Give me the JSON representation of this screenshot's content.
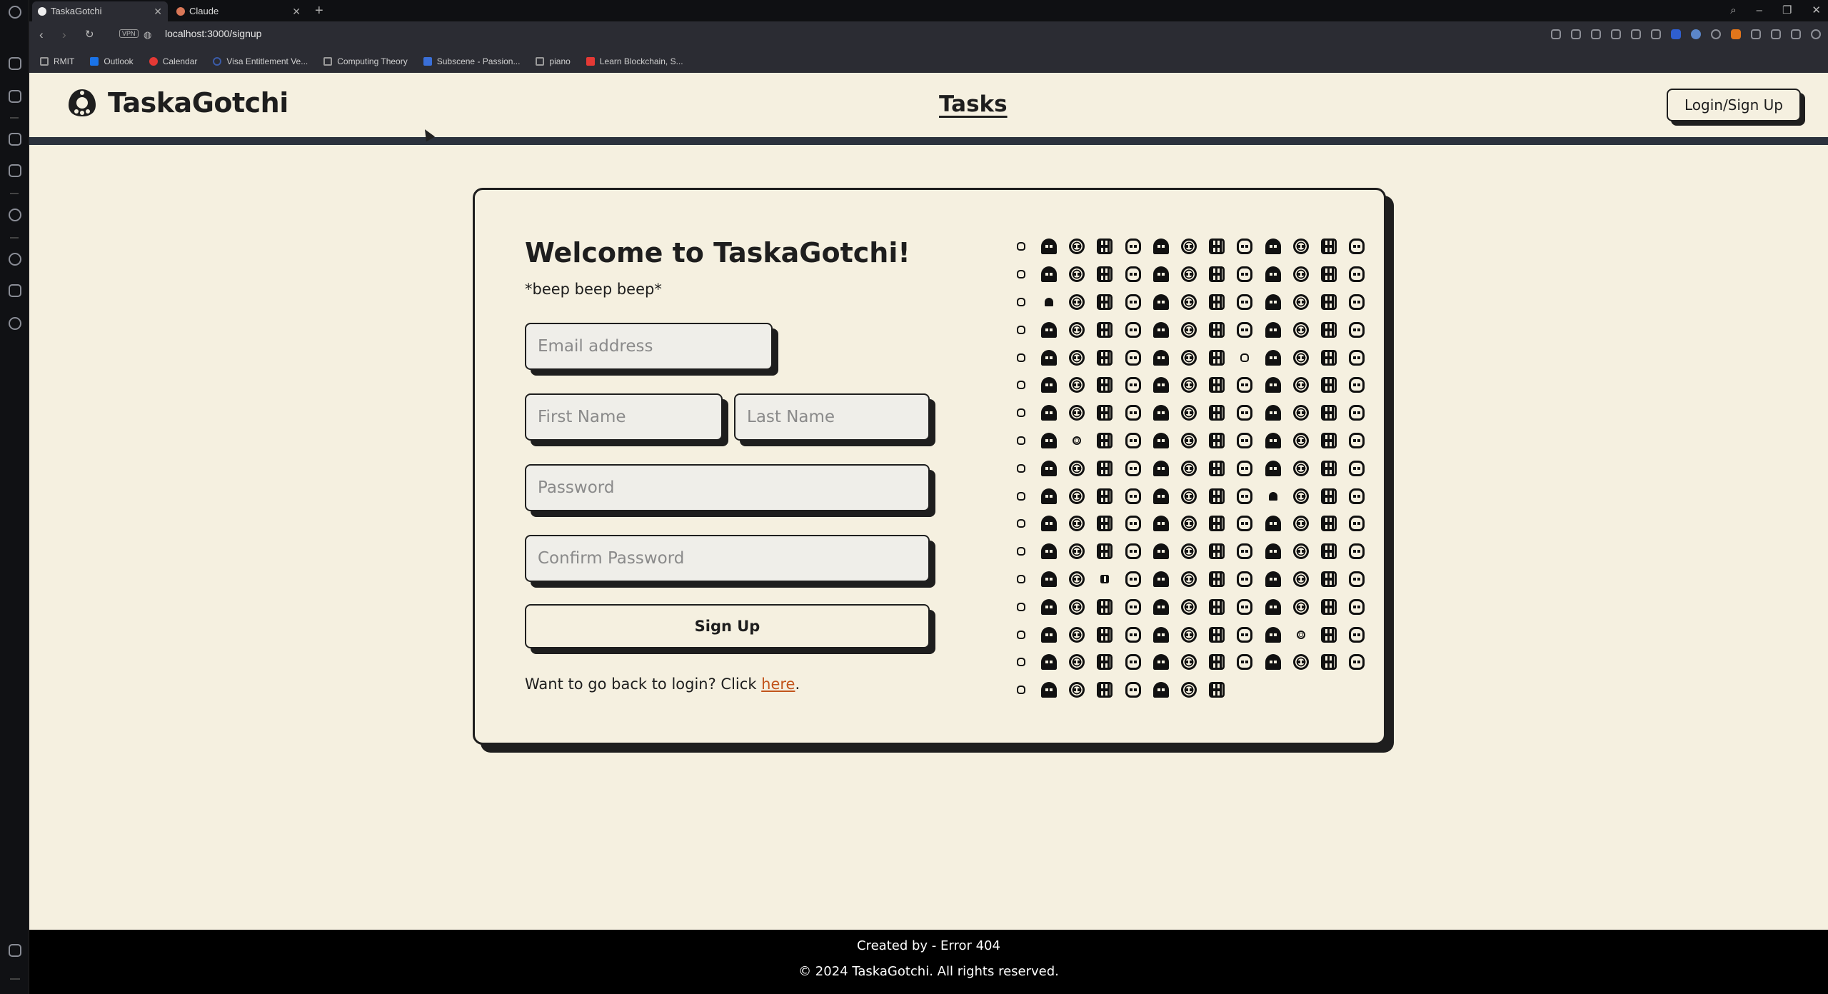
{
  "browser": {
    "tabs": [
      {
        "label": "TaskaGotchi",
        "active": true
      },
      {
        "label": "Claude",
        "active": false
      }
    ],
    "url": "localhost:3000/signup",
    "vpn_label": "VPN",
    "bookmarks": [
      {
        "label": "RMIT"
      },
      {
        "label": "Outlook"
      },
      {
        "label": "Calendar"
      },
      {
        "label": "Visa Entitlement Ve..."
      },
      {
        "label": "Computing Theory"
      },
      {
        "label": "Subscene - Passion..."
      },
      {
        "label": "piano"
      },
      {
        "label": "Learn Blockchain, S..."
      }
    ]
  },
  "header": {
    "brand": "TaskaGotchi",
    "nav_tasks": "Tasks",
    "login_label": "Login/Sign Up"
  },
  "signup": {
    "title": "Welcome to TaskaGotchi!",
    "subtitle": "*beep beep beep*",
    "email_placeholder": "Email address",
    "first_name_placeholder": "First Name",
    "last_name_placeholder": "Last Name",
    "password_placeholder": "Password",
    "confirm_password_placeholder": "Confirm Password",
    "submit_label": "Sign Up",
    "back_text": "Want to go back to login? Click ",
    "back_link": "here",
    "back_suffix": "."
  },
  "footer": {
    "credit": "Created by - Error 404",
    "copyright": "© 2024 TaskaGotchi. All rights reserved."
  },
  "colors": {
    "page_bg": "#f5f0e0",
    "ink": "#1e1e1e",
    "header_rule": "#2b323d",
    "link": "#c2541b",
    "footer_bg": "#000000"
  }
}
